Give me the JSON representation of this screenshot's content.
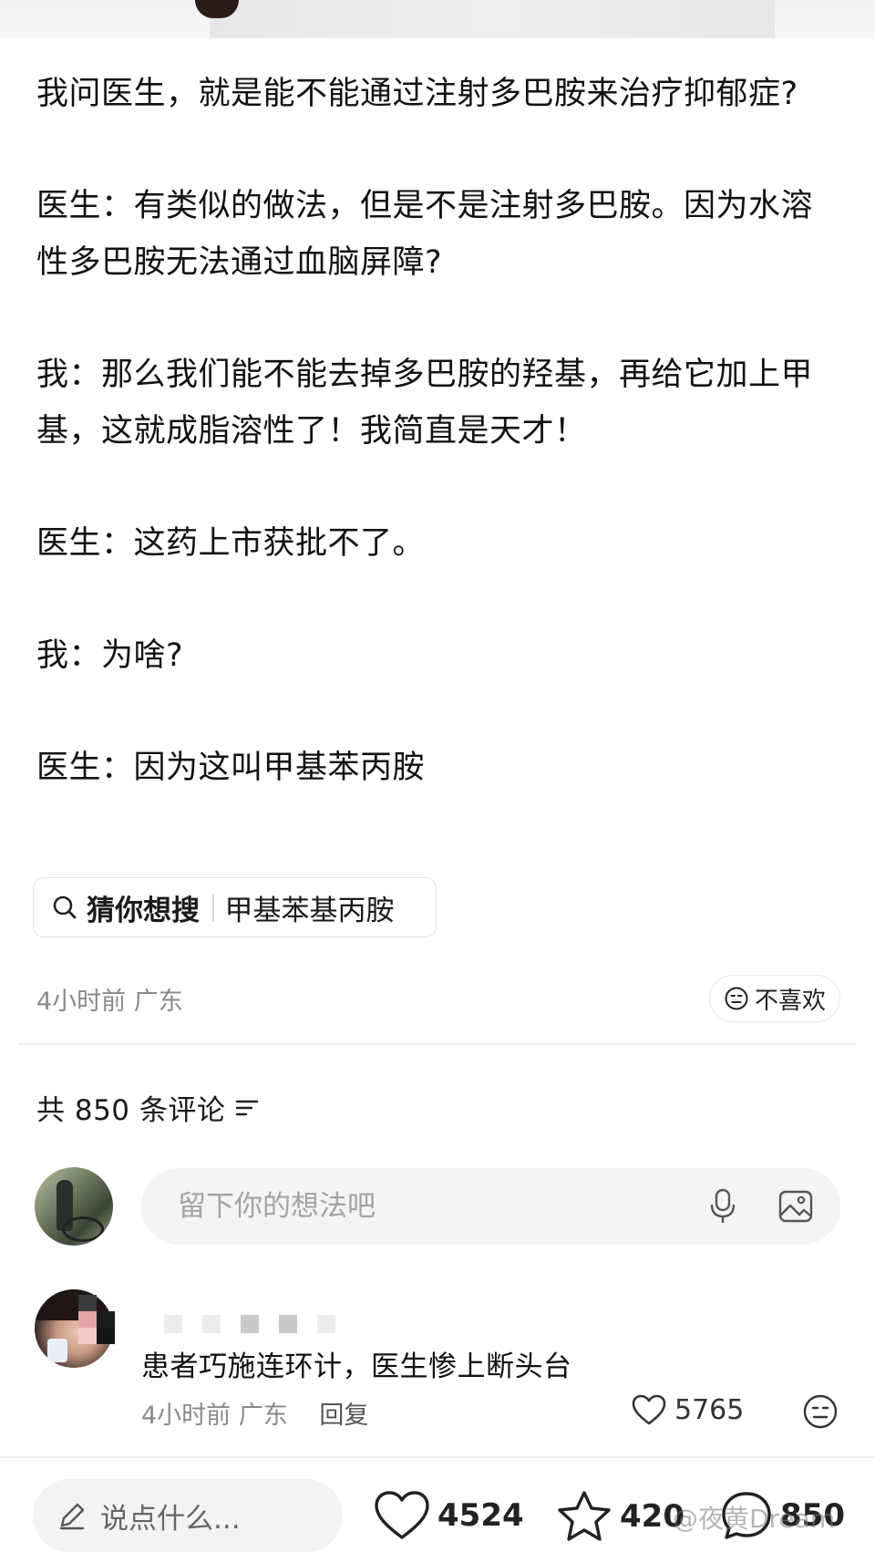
{
  "post": {
    "paragraphs": [
      "我问医生，就是能不能通过注射多巴胺来治疗抑郁症?",
      "医生：有类似的做法，但是不是注射多巴胺。因为水溶性多巴胺无法通过血脑屏障?",
      "我：那么我们能不能去掉多巴胺的羟基，再给它加上甲基，这就成脂溶性了！我简直是天才！",
      "医生：这药上市获批不了。",
      "我：为啥?",
      "医生：因为这叫甲基苯丙胺"
    ],
    "search_suggestion": {
      "label": "猜你想搜",
      "query": "甲基苯基丙胺"
    },
    "meta": "4小时前 广东",
    "dislike_label": "不喜欢"
  },
  "comments": {
    "header": "共 850 条评论",
    "input_placeholder": "留下你的想法吧",
    "items": [
      {
        "text": "患者巧施连环计，医生惨上断头台",
        "meta": "4小时前 广东",
        "reply_label": "回复",
        "likes": "5765"
      }
    ]
  },
  "bottom_bar": {
    "input_placeholder": "说点什么...",
    "likes": "4524",
    "favorites": "420",
    "comments": "850",
    "watermark": "@夜黄Dream"
  },
  "icons": {
    "search": "search-icon",
    "dislike": "face-icon",
    "sort": "sort-icon",
    "mic": "mic-icon",
    "image": "image-icon",
    "heart": "heart-icon",
    "star": "star-icon",
    "comment": "comment-icon",
    "pencil": "pencil-icon"
  },
  "colors": {
    "text": "#111111",
    "muted": "#8a8a8a",
    "input_bg": "#f4f4f4"
  }
}
